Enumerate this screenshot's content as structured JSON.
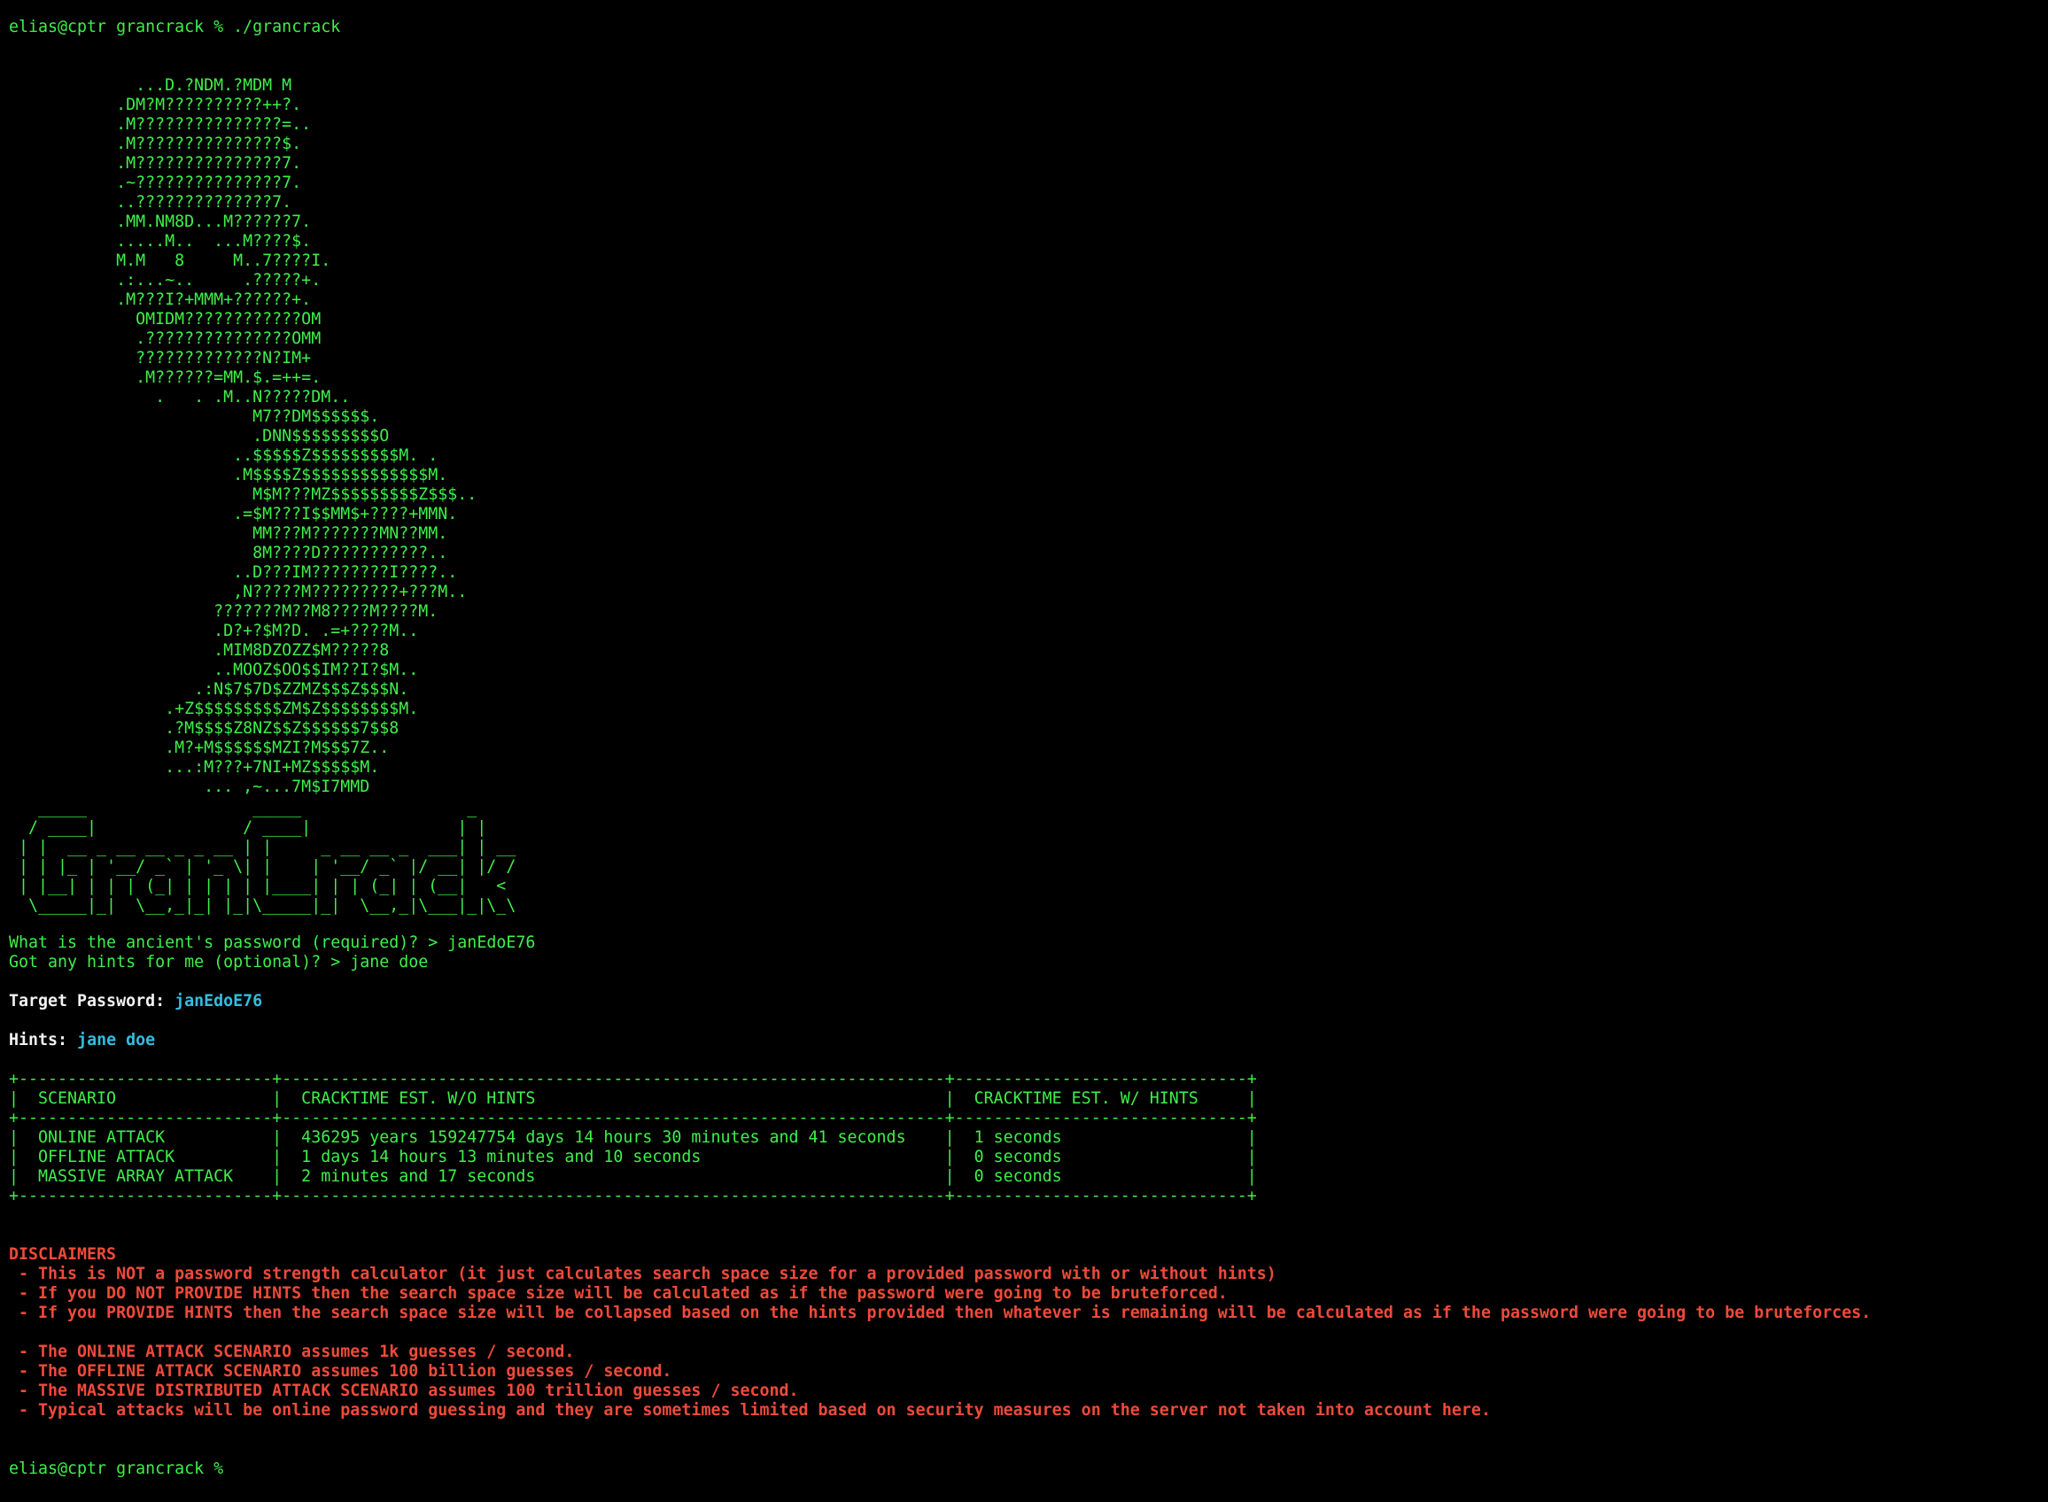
{
  "prompt": {
    "user_host_dir": "elias@cptr grancrack %",
    "command": "./grancrack"
  },
  "ascii_art": "             ...D.?NDM.?MDM M\n           .DM?M??????????++?.\n           .M???????????????=..\n           .M???????????????$.\n           .M???????????????7.\n           .~???????????????7.\n           ..??????????????7.\n           .MM.NM8D...M??????7.\n           .....M..  ...M????$.\n           M.M   8     M..7????I.\n           .:...~..     .?????+.\n           .M???I?+MMM+??????+.\n             OMIDM????????????OM\n             .???????????????OMM\n             ?????????????N?IM+\n             .M??????=MM.$.=++=.\n               .   . .M..N?????DM..\n                         M7??DM$$$$$$.\n                         .DNN$$$$$$$$$O\n                       ..$$$$$Z$$$$$$$$$M. .\n                       .M$$$$Z$$$$$$$$$$$$$M.\n                         M$M???MZ$$$$$$$$$Z$$$..\n                       .=$M???I$$MM$+????+MMN.\n                         MM???M???????MN??MM.\n                         8M????D???????????..\n                       ..D???IM????????I????..\n                       ,N?????M?????????+???M..\n                     ???????M??M8????M????M.\n                     .D?+?$M?D. .=+????M..\n                     .MIM8DZOZZ$M?????8\n                     ..MOOZ$OO$$IM??I?$M..\n                   .:N$7$7D$ZZMZ$$$Z$$$N.\n                .+Z$$$$$$$$$ZM$Z$$$$$$$$M.\n                .?M$$$$Z8NZ$$Z$$$$$$7$$8\n                .M?+M$$$$$$MZI?M$$$7Z..\n                ...:M???+7NI+MZ$$$$$M.\n                    ... ,~...7M$I7MMD",
  "banner": "   _____                 _____                 _\n  / ____|               / ____|               | |\n | |  __ _ __ __ _ _ __ | |     _ __ __ _  ___| | __\n | | |_ | '__/ _` | '_ \\| |    | '__/ _` |/ __| |/ /\n | |__| | | | (_| | | | | |____| | | (_| | (__|   <\n  \\_____|_|  \\__,_|_| |_|\\_____|_|  \\__,_|\\___|_|\\_\\",
  "questions": [
    {
      "prompt": "What is the ancient's password (required)? >",
      "answer": "janEdoE76"
    },
    {
      "prompt": "Got any hints for me (optional)? >",
      "answer": "jane doe"
    }
  ],
  "target": {
    "label": "Target Password:",
    "value": "janEdoE76"
  },
  "hints": {
    "label": "Hints:",
    "value": "jane doe"
  },
  "table": {
    "headers": [
      "SCENARIO",
      "CRACKTIME EST. W/O HINTS",
      "CRACKTIME EST. W/ HINTS"
    ],
    "rows": [
      [
        "ONLINE ATTACK",
        "436295 years 159247754 days 14 hours 30 minutes and 41 seconds",
        "1 seconds"
      ],
      [
        "OFFLINE ATTACK",
        "1 days 14 hours 13 minutes and 10 seconds",
        "0 seconds"
      ],
      [
        "MASSIVE ARRAY ATTACK",
        "2 minutes and 17 seconds",
        "0 seconds"
      ]
    ]
  },
  "disclaimers": {
    "title": "DISCLAIMERS",
    "group1": [
      " - This is NOT a password strength calculator (it just calculates search space size for a provided password with or without hints)",
      " - If you DO NOT PROVIDE HINTS then the search space size will be calculated as if the password were going to be bruteforced.",
      " - If you PROVIDE HINTS then the search space size will be collapsed based on the hints provided then whatever is remaining will be calculated as if the password were going to be bruteforces."
    ],
    "group2": [
      " - The ONLINE ATTACK SCENARIO assumes 1k guesses / second.",
      " - The OFFLINE ATTACK SCENARIO assumes 100 billion guesses / second.",
      " - The MASSIVE DISTRIBUTED ATTACK SCENARIO assumes 100 trillion guesses / second.",
      " - Typical attacks will be online password guessing and they are sometimes limited based on security measures on the server not taken into account here."
    ]
  },
  "final_prompt": "elias@cptr grancrack %",
  "colors": {
    "background": "#000000",
    "output_green": "#3ef04a",
    "label_white": "#f2f2f2",
    "value_cyan": "#33bde0",
    "disclaimer_red": "#f04a3a"
  }
}
